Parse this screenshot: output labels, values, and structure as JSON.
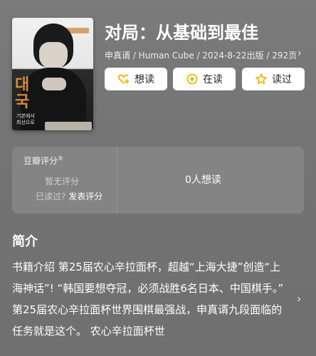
{
  "book": {
    "title": "对局：从基础到最佳",
    "meta": "申真谞 / Human Cube / 2024-8-22出版 / 292页",
    "meta_arrow": "›",
    "cover": {
      "korean": "대\n국",
      "subtitle": "기본에서\n최선으로"
    }
  },
  "actions": {
    "want": "想读",
    "reading": "在读",
    "read": "读过"
  },
  "rating": {
    "title": "豆瓣评分",
    "reg": "®",
    "no_rating": "暂无评分",
    "read_question": "已读过?",
    "post_link": "发表评分",
    "want_count": "0人想读"
  },
  "intro": {
    "title": "简介",
    "text": "书籍介绍 第25届农心辛拉面杯，超越“上海大捷”创造“上海神话”! “韩国要想夺冠，必须战胜6名日本、中国棋手。” 第25届农心辛拉面杯世界围棋最强战，申真谞九段面临的任务就是这个。 农心辛拉面杯世",
    "arrow": "›"
  },
  "colors": {
    "accent_yellow": "#f0b400",
    "background": "#767676",
    "button_bg": "#ffffff"
  },
  "icons": [
    "heart-plus-icon",
    "target-circle-icon",
    "star-icon",
    "chevron-right-icon"
  ]
}
